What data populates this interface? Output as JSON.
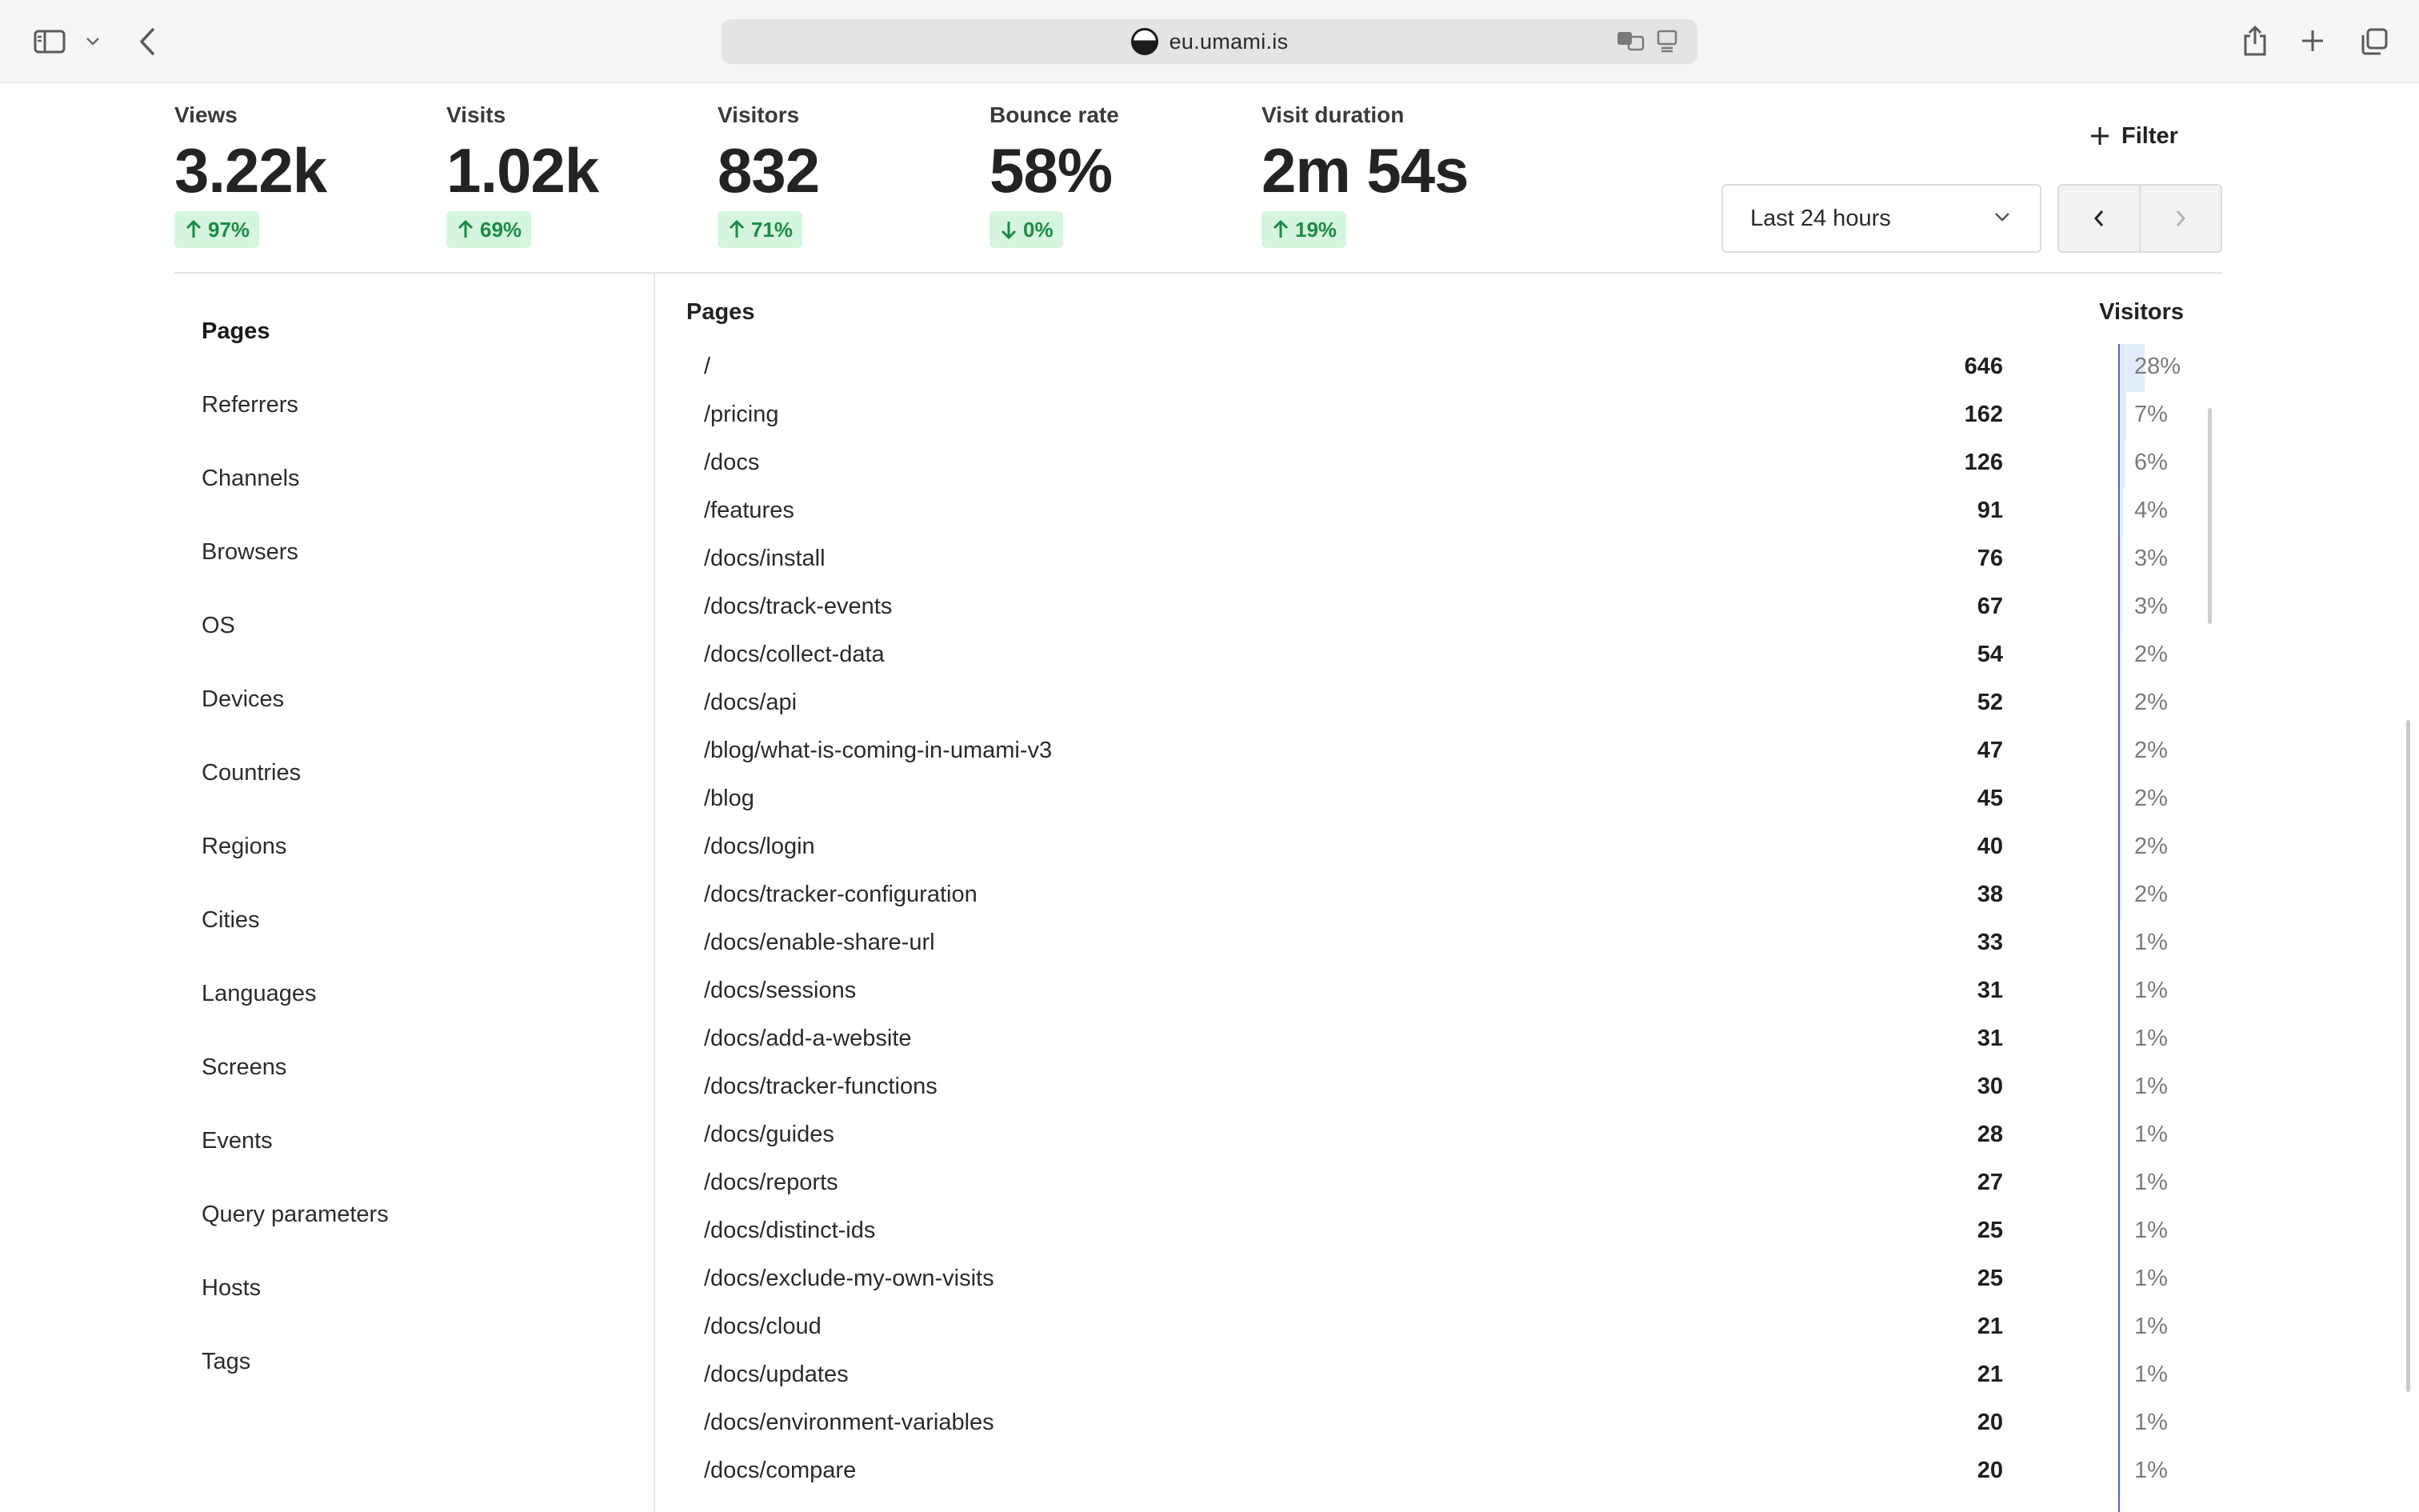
{
  "browser": {
    "url": "eu.umami.is"
  },
  "metrics": [
    {
      "label": "Views",
      "value": "3.22k",
      "change": "97%",
      "direction": "up"
    },
    {
      "label": "Visits",
      "value": "1.02k",
      "change": "69%",
      "direction": "up"
    },
    {
      "label": "Visitors",
      "value": "832",
      "change": "71%",
      "direction": "up"
    },
    {
      "label": "Bounce rate",
      "value": "58%",
      "change": "0%",
      "direction": "down"
    },
    {
      "label": "Visit duration",
      "value": "2m 54s",
      "change": "19%",
      "direction": "up"
    }
  ],
  "controls": {
    "filter_label": "Filter",
    "date_range": "Last 24 hours"
  },
  "sidebar": {
    "items": [
      {
        "label": "Pages",
        "active": true
      },
      {
        "label": "Referrers",
        "active": false
      },
      {
        "label": "Channels",
        "active": false
      },
      {
        "label": "Browsers",
        "active": false
      },
      {
        "label": "OS",
        "active": false
      },
      {
        "label": "Devices",
        "active": false
      },
      {
        "label": "Countries",
        "active": false
      },
      {
        "label": "Regions",
        "active": false
      },
      {
        "label": "Cities",
        "active": false
      },
      {
        "label": "Languages",
        "active": false
      },
      {
        "label": "Screens",
        "active": false
      },
      {
        "label": "Events",
        "active": false
      },
      {
        "label": "Query parameters",
        "active": false
      },
      {
        "label": "Hosts",
        "active": false
      },
      {
        "label": "Tags",
        "active": false
      }
    ]
  },
  "table": {
    "header_label": "Pages",
    "header_metric": "Visitors",
    "rows": [
      {
        "path": "/",
        "visitors": "646",
        "percent": "28%"
      },
      {
        "path": "/pricing",
        "visitors": "162",
        "percent": "7%"
      },
      {
        "path": "/docs",
        "visitors": "126",
        "percent": "6%"
      },
      {
        "path": "/features",
        "visitors": "91",
        "percent": "4%"
      },
      {
        "path": "/docs/install",
        "visitors": "76",
        "percent": "3%"
      },
      {
        "path": "/docs/track-events",
        "visitors": "67",
        "percent": "3%"
      },
      {
        "path": "/docs/collect-data",
        "visitors": "54",
        "percent": "2%"
      },
      {
        "path": "/docs/api",
        "visitors": "52",
        "percent": "2%"
      },
      {
        "path": "/blog/what-is-coming-in-umami-v3",
        "visitors": "47",
        "percent": "2%"
      },
      {
        "path": "/blog",
        "visitors": "45",
        "percent": "2%"
      },
      {
        "path": "/docs/login",
        "visitors": "40",
        "percent": "2%"
      },
      {
        "path": "/docs/tracker-configuration",
        "visitors": "38",
        "percent": "2%"
      },
      {
        "path": "/docs/enable-share-url",
        "visitors": "33",
        "percent": "1%"
      },
      {
        "path": "/docs/sessions",
        "visitors": "31",
        "percent": "1%"
      },
      {
        "path": "/docs/add-a-website",
        "visitors": "31",
        "percent": "1%"
      },
      {
        "path": "/docs/tracker-functions",
        "visitors": "30",
        "percent": "1%"
      },
      {
        "path": "/docs/guides",
        "visitors": "28",
        "percent": "1%"
      },
      {
        "path": "/docs/reports",
        "visitors": "27",
        "percent": "1%"
      },
      {
        "path": "/docs/distinct-ids",
        "visitors": "25",
        "percent": "1%"
      },
      {
        "path": "/docs/exclude-my-own-visits",
        "visitors": "25",
        "percent": "1%"
      },
      {
        "path": "/docs/cloud",
        "visitors": "21",
        "percent": "1%"
      },
      {
        "path": "/docs/updates",
        "visitors": "21",
        "percent": "1%"
      },
      {
        "path": "/docs/environment-variables",
        "visitors": "20",
        "percent": "1%"
      },
      {
        "path": "/docs/compare",
        "visitors": "20",
        "percent": "1%"
      }
    ]
  }
}
